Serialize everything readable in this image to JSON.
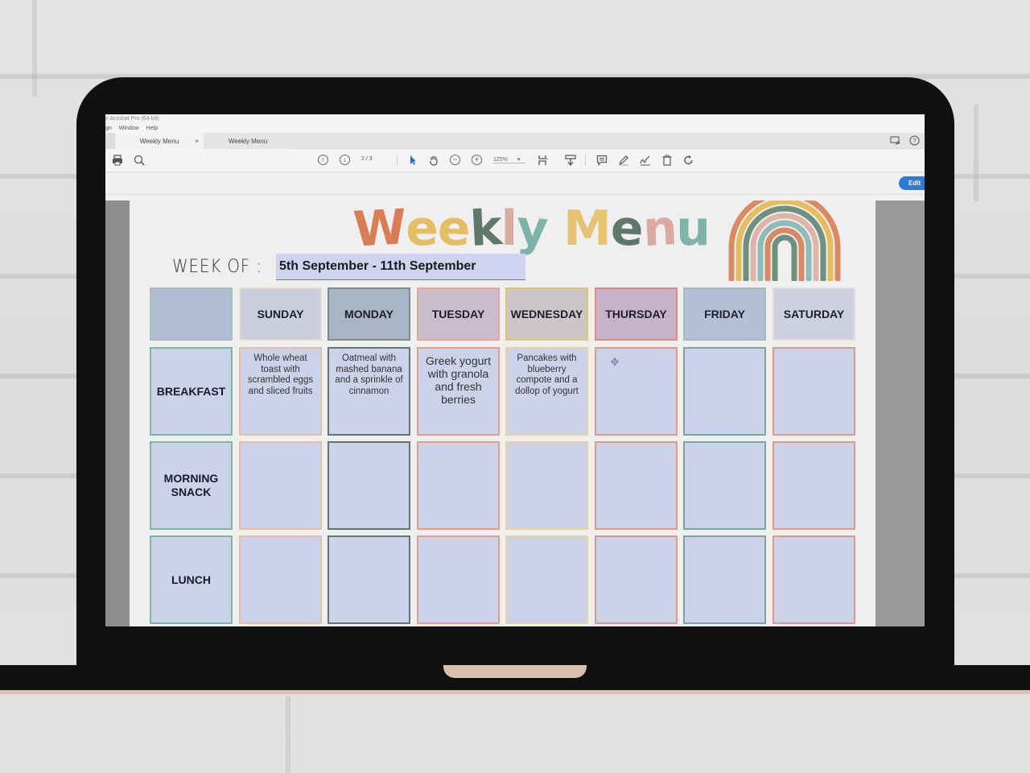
{
  "app": {
    "title": "e Acrobat Pro (64-bit)",
    "menu": [
      "gn",
      "Window",
      "Help"
    ]
  },
  "tabs": [
    {
      "label": "Weekly Menu",
      "active": true,
      "close": "×"
    },
    {
      "label": "Weekly Menu",
      "active": false
    }
  ],
  "toolbar": {
    "icons": [
      "print-icon",
      "search-zoom-icon",
      "page-up-icon",
      "page-down-icon",
      "select-cursor-icon",
      "hand-tool-icon",
      "zoom-out-icon",
      "zoom-in-icon",
      "fit-page-icon",
      "scroll-mode-icon",
      "comment-icon",
      "highlight-pen-icon",
      "sign-icon",
      "delete-icon",
      "rotate-icon"
    ],
    "page_current": "2",
    "page_total": "/ 3",
    "zoom_level": "125%",
    "zoom_caret": "▾",
    "edit_label": "Edit"
  },
  "document": {
    "title_letters": [
      {
        "ch": "W",
        "color": "#d97d57"
      },
      {
        "ch": "e",
        "color": "#e5bd63"
      },
      {
        "ch": "e",
        "color": "#e5bd63"
      },
      {
        "ch": "k",
        "color": "#5e786b"
      },
      {
        "ch": "l",
        "color": "#d9aa9d"
      },
      {
        "ch": "y",
        "color": "#7db3a8"
      },
      {
        "ch": " ",
        "color": "#000000"
      },
      {
        "ch": "M",
        "color": "#e5c373"
      },
      {
        "ch": "e",
        "color": "#5e786b"
      },
      {
        "ch": "n",
        "color": "#d9aa9d"
      },
      {
        "ch": "u",
        "color": "#7db3a8"
      }
    ],
    "week_label": "WEEK OF :",
    "week_value": "5th September - 11th September",
    "rainbow_colors": [
      "#d98a62",
      "#e6bd5c",
      "#6f8f7f",
      "#e0b5a9",
      "#8fbcb8",
      "#d98a62",
      "#6f8f7f"
    ],
    "days": [
      {
        "label": "",
        "bg": "#aebdd3",
        "border": "#a6bcbf"
      },
      {
        "label": "SUNDAY",
        "bg": "#ccccdf",
        "border": "#e9dccb"
      },
      {
        "label": "MONDAY",
        "bg": "#a9b4c4",
        "border": "#7c8c84"
      },
      {
        "label": "TUESDAY",
        "bg": "#cbbccd",
        "border": "#e8a690"
      },
      {
        "label": "WEDNESDAY",
        "bg": "#cbc6c7",
        "border": "#e6c26a"
      },
      {
        "label": "THURSDAY",
        "bg": "#c7b3c8",
        "border": "#e48886"
      },
      {
        "label": "FRIDAY",
        "bg": "#b2c0d6",
        "border": "#a6bcbf"
      },
      {
        "label": "SATURDAY",
        "bg": "#cfcfe2",
        "border": "#e6dcd8"
      }
    ],
    "col_borders": [
      "#7fb4a3",
      "#e3bfa8",
      "#5f7771",
      "#e79c86",
      "#e8d39c",
      "#d99c86",
      "#78a6a0",
      "#d99c86"
    ],
    "rows": [
      {
        "label": "BREAKFAST",
        "meals": [
          "Whole wheat toast with scrambled eggs and sliced fruits",
          "Oatmeal with mashed banana and a sprinkle of cinnamon",
          "Greek yogurt with granola and fresh berries",
          "Pancakes with blueberry compote and a dollop of yogurt",
          "",
          "",
          ""
        ]
      },
      {
        "label": "MORNING SNACK",
        "meals": [
          "",
          "",
          "",
          "",
          "",
          "",
          ""
        ]
      },
      {
        "label": "LUNCH",
        "meals": [
          "",
          "",
          "",
          "",
          "",
          "",
          ""
        ]
      }
    ]
  }
}
